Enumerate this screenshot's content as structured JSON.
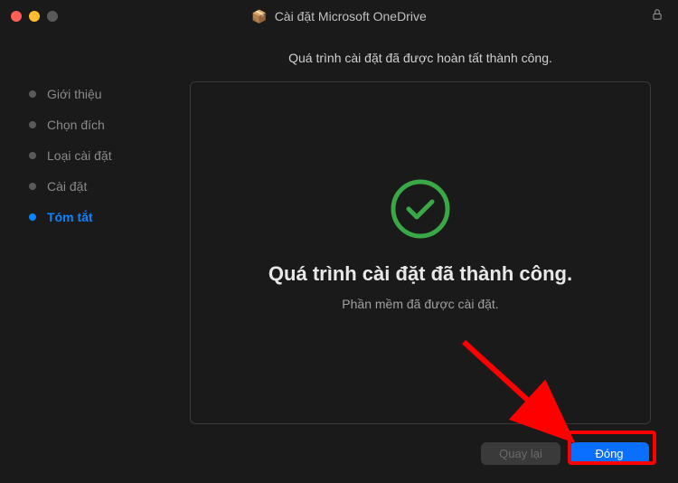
{
  "window": {
    "title": "Cài đặt Microsoft OneDrive"
  },
  "sidebar": {
    "steps": [
      {
        "label": "Giới thiệu",
        "active": false
      },
      {
        "label": "Chọn đích",
        "active": false
      },
      {
        "label": "Loại cài đặt",
        "active": false
      },
      {
        "label": "Cài đặt",
        "active": false
      },
      {
        "label": "Tóm tắt",
        "active": true
      }
    ]
  },
  "main": {
    "header": "Quá trình cài đặt đã được hoàn tất thành công.",
    "success_title": "Quá trình cài đặt đã thành công.",
    "success_subtitle": "Phần mềm đã được cài đặt."
  },
  "buttons": {
    "back": "Quay lại",
    "close": "Đóng"
  },
  "colors": {
    "accent": "#0a84ff",
    "success": "#3aa847",
    "highlight": "#ff0000"
  }
}
